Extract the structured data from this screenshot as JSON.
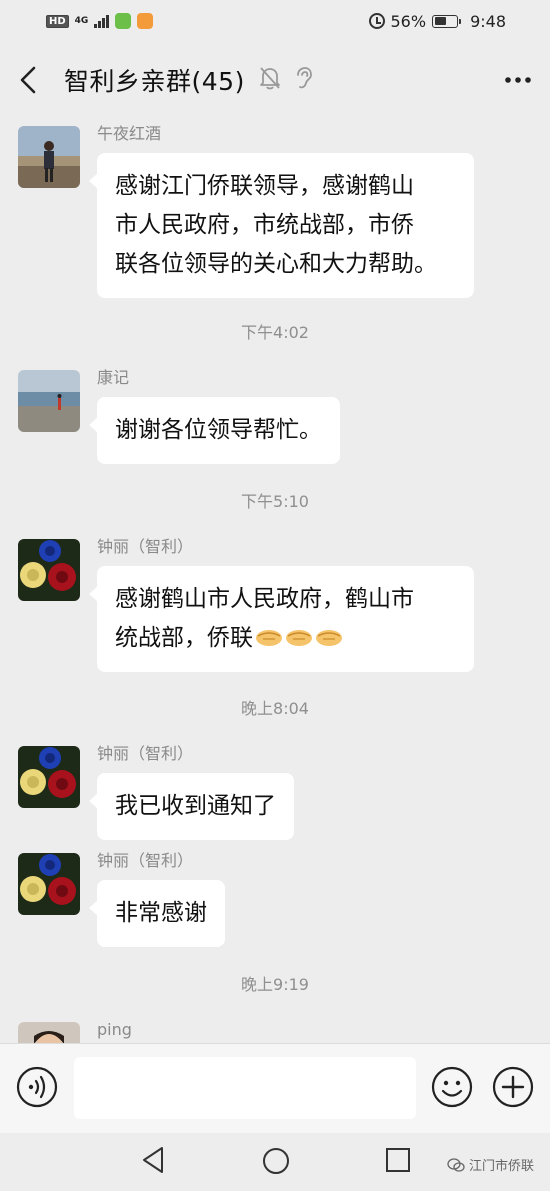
{
  "status_bar": {
    "network": "4G",
    "hd": "HD",
    "battery": "56%",
    "battery_level": 0.56,
    "time": "9:48"
  },
  "header": {
    "title": "智利乡亲群(45)",
    "icons": [
      "back-icon",
      "mute-icon",
      "ear-icon",
      "more-icon"
    ]
  },
  "messages": [
    {
      "sender": "午夜红酒",
      "lines": [
        "感谢江门侨联领导，感谢鹤山",
        "市人民政府，市统战部，市侨",
        "联各位领导的关心和大力帮助。"
      ]
    },
    {
      "time": "下午4:02"
    },
    {
      "sender": "康记",
      "lines": [
        "谢谢各位领导帮忙。"
      ]
    },
    {
      "time": "下午5:10"
    },
    {
      "sender": "钟丽（智利）",
      "lines": [
        "感谢鹤山市人民政府，鹤山市",
        "统战部，侨联"
      ],
      "emoji": "handshake-icon"
    },
    {
      "time": "晚上8:04"
    },
    {
      "sender": "钟丽（智利）",
      "lines": [
        "我已收到通知了"
      ]
    },
    {
      "sender": "钟丽（智利）",
      "lines": [
        "非常感谢"
      ]
    },
    {
      "time": "晚上9:19"
    },
    {
      "sender": "ping",
      "lines": []
    }
  ],
  "input_bar": {
    "placeholder": "",
    "icons": [
      "voice-icon",
      "emoji-icon",
      "plus-icon"
    ]
  },
  "watermark": "江门市侨联",
  "colors": {
    "background": "#ededed",
    "bubble": "#ffffff",
    "sender_text": "#8a8a8a",
    "time_text": "#8f8f8f"
  }
}
